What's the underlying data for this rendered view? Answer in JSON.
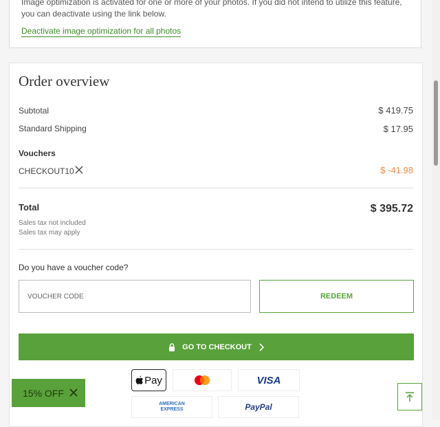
{
  "notice": {
    "text": "Image optimization is activated for one or more of your photos. If you did not intend to utilize this feature, you can deactivate using the link below.",
    "link": "Deactivate image optimization for all photos"
  },
  "order": {
    "title": "Order overview",
    "subtotal_label": "Subtotal",
    "subtotal_value": "$ 419.75",
    "shipping_label": "Standard Shipping",
    "shipping_value": "$ 17.95",
    "vouchers_heading": "Vouchers",
    "voucher_code": "CHECKOUT10",
    "voucher_discount": "$ -41.98",
    "total_label": "Total",
    "total_value": "$ 395.72",
    "tax_note_1": "Sales tax not included",
    "tax_note_2": "Sales tax may apply",
    "voucher_question": "Do you have a voucher code?",
    "voucher_placeholder": "VOUCHER CODE",
    "redeem_label": "REDEEM",
    "checkout_label": "GO TO CHECKOUT"
  },
  "payment_methods": {
    "apple_pay": "Pay",
    "visa": "VISA",
    "amex_line1": "AMERICAN",
    "amex_line2": "EXPRESS",
    "paypal": "PayPal"
  },
  "promo": {
    "label": "15% OFF"
  },
  "colors": {
    "accent_green": "#59a13a",
    "discount_orange": "#ee8a44",
    "link_green": "#3d8b2a"
  },
  "icons": [
    "close-icon",
    "lock-icon",
    "chevron-right-icon",
    "arrow-up-icon",
    "apple-icon",
    "mastercard-icon"
  ]
}
